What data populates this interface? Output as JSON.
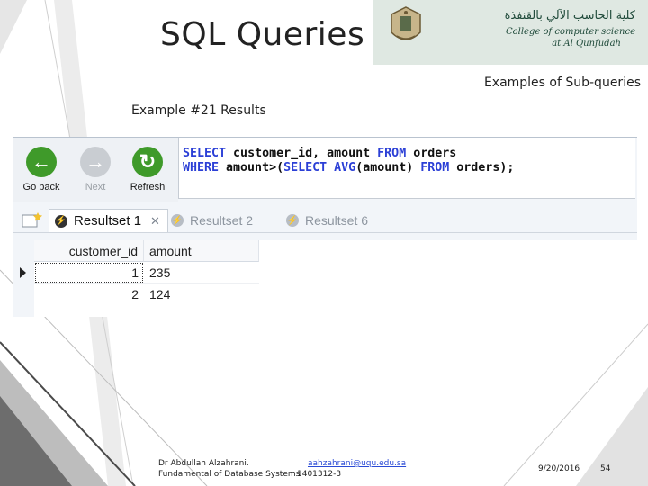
{
  "slide": {
    "title": "SQL Queries",
    "subtitle": "Examples of Sub-queries",
    "example_heading": "Example #21 Results"
  },
  "logo": {
    "arabic_text": "كلية الحاسب الآلي بالقنفذة",
    "english_line1": "College of computer science",
    "english_line2": "at Al Qunfudah"
  },
  "toolbar": {
    "back_label": "Go back",
    "next_label": "Next",
    "refresh_label": "Refresh"
  },
  "editor": {
    "line1": {
      "kw1": "SELECT",
      "t1": " customer_id, amount ",
      "kw2": "FROM",
      "t2": " orders"
    },
    "line2": {
      "kw1": "WHERE",
      "t1": " amount>(",
      "kw2": "SELECT",
      "t2": " ",
      "kw3": "AVG",
      "t3": "(amount) ",
      "kw4": "FROM",
      "t4": " orders);"
    }
  },
  "tabs": [
    {
      "label": "Resultset 1",
      "active": true
    },
    {
      "label": "Resultset 2",
      "active": false
    },
    {
      "label": "Resultset 6",
      "active": false
    }
  ],
  "results": {
    "columns": [
      "customer_id",
      "amount"
    ],
    "rows": [
      [
        "1",
        "235"
      ],
      [
        "2",
        "124"
      ]
    ]
  },
  "footer": {
    "author": "Dr Abdullah Alzahrani.",
    "email": "aahzahrani@uqu.edu.sa",
    "course": "Fundamental of Database Systems",
    "course_code": "1401312-3",
    "date": "9/20/2016",
    "page": "54"
  },
  "colors": {
    "accent_green": "#3f9a2a",
    "keyword_blue": "#2b3fd6",
    "logo_bg": "#dfe8e2"
  }
}
